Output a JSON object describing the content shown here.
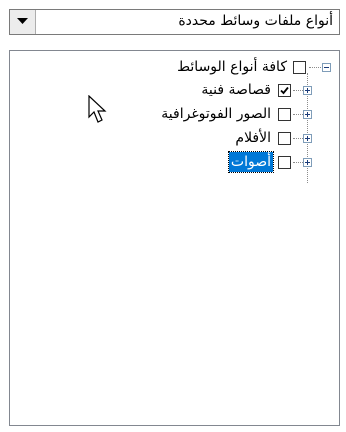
{
  "dropdown": {
    "selected_value": "أنواع ملفات وسائط محددة",
    "arrow_icon": "triangle-down-icon"
  },
  "tree": {
    "root": {
      "label": "كافة أنواع الوسائط",
      "checked": false,
      "expanded": true
    },
    "children": [
      {
        "label": "قصاصة فنية",
        "checked": true,
        "selected": false
      },
      {
        "label": "الصور الفوتوغرافية",
        "checked": false,
        "selected": false
      },
      {
        "label": "الأفلام",
        "checked": false,
        "selected": false
      },
      {
        "label": "أصوات",
        "checked": false,
        "selected": true
      }
    ]
  },
  "colors": {
    "selection": "#0078d7",
    "expander_border": "#7f9db9"
  }
}
